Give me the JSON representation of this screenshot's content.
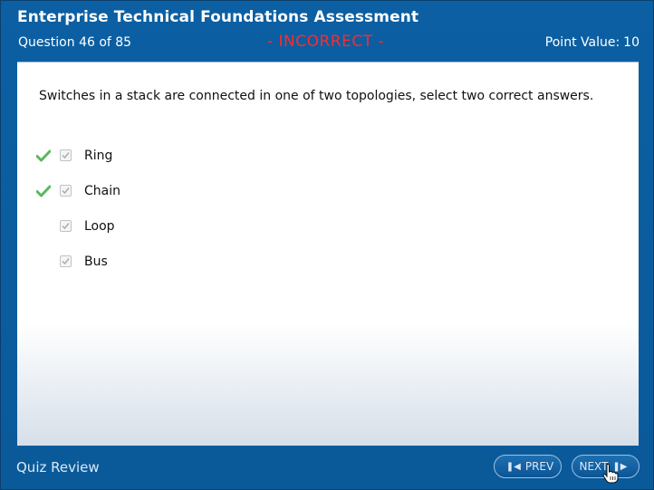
{
  "header": {
    "title": "Enterprise Technical Foundations Assessment",
    "question_progress": "Question 46 of 85",
    "status": "- INCORRECT -",
    "point_label": "Point Value:",
    "point_value": "10"
  },
  "question": {
    "text": "Switches in a stack are connected in one of two topologies, select two correct answers.",
    "answers": [
      {
        "label": "Ring",
        "correct": true,
        "checked": true
      },
      {
        "label": "Chain",
        "correct": true,
        "checked": true
      },
      {
        "label": "Loop",
        "correct": false,
        "checked": true
      },
      {
        "label": "Bus",
        "correct": false,
        "checked": true
      }
    ]
  },
  "footer": {
    "label": "Quiz Review",
    "prev_label": "PREV",
    "next_label": "NEXT"
  },
  "colors": {
    "frame": "#0b5fa2",
    "status": "#ff2a2a",
    "correct_check": "#5cb85c"
  },
  "icons": {
    "correct": "checkmark-icon",
    "prev": "prev-icon",
    "next": "next-icon",
    "cursor": "hand-cursor-icon"
  }
}
